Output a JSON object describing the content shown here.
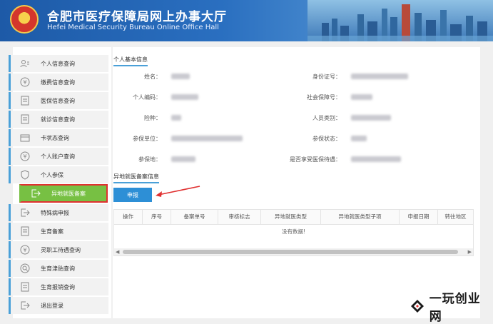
{
  "header": {
    "title_cn": "合肥市医疗保障局网上办事大厅",
    "title_en": "Hefei Medical Security Bureau Online Office Hall",
    "emblem_icon": "national-emblem-icon"
  },
  "sidebar": {
    "items": [
      {
        "label": "个人信息查询",
        "icon": "user-card-icon"
      },
      {
        "label": "缴费信息查询",
        "icon": "yuan-coin-icon"
      },
      {
        "label": "医保信息查询",
        "icon": "document-icon"
      },
      {
        "label": "就诊信息查询",
        "icon": "document-icon"
      },
      {
        "label": "卡状态查询",
        "icon": "card-icon"
      },
      {
        "label": "个人账户查询",
        "icon": "yuan-coin-icon"
      },
      {
        "label": "个人参保",
        "icon": "shield-icon"
      },
      {
        "label": "异地就医备案",
        "icon": "exit-arrow-icon",
        "active": true
      },
      {
        "label": "特殊病申报",
        "icon": "exit-arrow-icon"
      },
      {
        "label": "生育备案",
        "icon": "document-icon"
      },
      {
        "label": "灵职工待遇查询",
        "icon": "yuan-coin-icon"
      },
      {
        "label": "生育津贴查询",
        "icon": "search-icon"
      },
      {
        "label": "生育报销查询",
        "icon": "document-icon"
      },
      {
        "label": "退出登录",
        "icon": "logout-icon"
      }
    ]
  },
  "basic_info": {
    "section_title": "个人基本信息",
    "fields": [
      {
        "label": "姓名："
      },
      {
        "label": "身份证号："
      },
      {
        "label": "个人编码："
      },
      {
        "label": "社会保障号："
      },
      {
        "label": "险种："
      },
      {
        "label": "人员类别："
      },
      {
        "label": "参保单位："
      },
      {
        "label": "参保状态："
      },
      {
        "label": "参保地："
      },
      {
        "label": "是否享受医保待遇："
      }
    ]
  },
  "record": {
    "section_title": "异地就医备案信息",
    "apply_label": "申报",
    "columns": [
      "操作",
      "序号",
      "备案单号",
      "审核标志",
      "异地就医类型",
      "异地就医类型子项",
      "申报日期",
      "转往地区"
    ],
    "empty_text": "没有数据!"
  },
  "watermark": {
    "text": "一玩创业网"
  },
  "colors": {
    "header_blue": "#1d5aa7",
    "accent_blue": "#2d8fd6",
    "active_green": "#77c043",
    "highlight_red": "#e03030"
  }
}
